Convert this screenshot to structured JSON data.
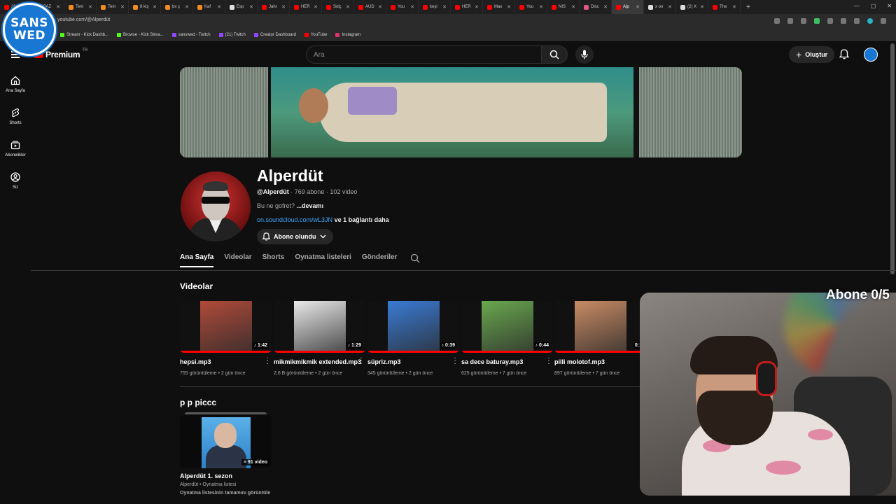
{
  "browser": {
    "tabs": [
      {
        "label": "202",
        "color": "#ff0000"
      },
      {
        "label": "PAZ",
        "color": "#ff0000"
      },
      {
        "label": "Tem",
        "color": "#f28b22"
      },
      {
        "label": "Tem",
        "color": "#f28b22"
      },
      {
        "label": "8 kiş",
        "color": "#f28b22"
      },
      {
        "label": "bx ç",
        "color": "#f28b22"
      },
      {
        "label": "Kaf",
        "color": "#f28b22"
      },
      {
        "label": "Esp",
        "color": "#dddddd"
      },
      {
        "label": "Jahr",
        "color": "#ff0000"
      },
      {
        "label": "HER",
        "color": "#ff0000"
      },
      {
        "label": "Solç",
        "color": "#ff0000"
      },
      {
        "label": "AUD",
        "color": "#ff0000"
      },
      {
        "label": "You",
        "color": "#ff0000"
      },
      {
        "label": "keşi",
        "color": "#ff0000"
      },
      {
        "label": "HER",
        "color": "#ff0000"
      },
      {
        "label": "Max",
        "color": "#ff0000"
      },
      {
        "label": "You",
        "color": "#ff0000"
      },
      {
        "label": "NIS",
        "color": "#ff0000"
      },
      {
        "label": "Disc",
        "color": "#e0577f"
      },
      {
        "label": "Alp",
        "color": "#ff0000",
        "active": true
      },
      {
        "label": "x on",
        "color": "#dddddd"
      },
      {
        "label": "(2) X",
        "color": "#dddddd"
      },
      {
        "label": "The",
        "color": "#ff0000"
      }
    ],
    "new_tab": "+",
    "url": "youtube.com/@Alperdüt",
    "bookmarks": [
      {
        "label": "Stream - Kick Dashb...",
        "color": "#53fc18"
      },
      {
        "label": "Browse - Kick Strea...",
        "color": "#53fc18"
      },
      {
        "label": "sanswed - Twitch",
        "color": "#9146ff"
      },
      {
        "label": "(21) Twitch",
        "color": "#9146ff"
      },
      {
        "label": "Creator Dashboard",
        "color": "#9146ff"
      },
      {
        "label": "YouTube",
        "color": "#ff0000"
      },
      {
        "label": "Instagram",
        "color": "#e1306c"
      }
    ]
  },
  "overlay": {
    "logo_line1": "SANS",
    "logo_line2": "WED",
    "cam_label": "Abone 0/5"
  },
  "header": {
    "logo_text": "Premium",
    "logo_region": "TR",
    "search_placeholder": "Ara",
    "create_label": "Oluştur"
  },
  "sidebar": {
    "items": [
      {
        "label": "Ana Sayfa",
        "icon": "home-icon"
      },
      {
        "label": "Shorts",
        "icon": "shorts-icon"
      },
      {
        "label": "Abonelikler",
        "icon": "subscriptions-icon"
      },
      {
        "label": "Siz",
        "icon": "you-icon"
      }
    ]
  },
  "channel": {
    "name": "Alperdüt",
    "handle": "@Alperdüt",
    "stats": " · 769 abone · 102 video",
    "description": "Bu ne gofret? ",
    "more": "...devamı",
    "link": "on.soundcloud.com/wL3JN",
    "link_extra": " ve 1 bağlantı daha",
    "subscribe_label": "Abone olundu"
  },
  "tabs": [
    "Ana Sayfa",
    "Videolar",
    "Shorts",
    "Oynatma listeleri",
    "Gönderiler"
  ],
  "videos_section": {
    "title": "Videolar",
    "items": [
      {
        "title": "hepsi.mp3",
        "meta": "755 görüntüleme • 2 gün önce",
        "duration": "♪ 1:42",
        "color": "#b04a3a"
      },
      {
        "title": "mikmikmikmik extended.mp3",
        "meta": "2,6 B görüntüleme • 2 gün önce",
        "duration": "♪ 1:29",
        "color": "#e9e9e9"
      },
      {
        "title": "süpriz.mp3",
        "meta": "345 görüntüleme • 2 gün önce",
        "duration": "♪ 0:39",
        "color": "#3a7bd5"
      },
      {
        "title": "sa dece baturay.mp3",
        "meta": "625 görüntüleme • 7 gün önce",
        "duration": "♪ 0:44",
        "color": "#6aa84f"
      },
      {
        "title": "pilli molotof.mp3",
        "meta": "897 görüntüleme • 7 gün önce",
        "duration": "0:1",
        "color": "#c98b64"
      }
    ]
  },
  "playlist_section": {
    "title": "p p piccc",
    "item": {
      "title": "Alperdüt 1. sezon",
      "owner": "Alperdüt • Oynatma listesi",
      "count": "91 video",
      "view_all": "Oynatma listesinin tamamını görüntüle"
    }
  }
}
